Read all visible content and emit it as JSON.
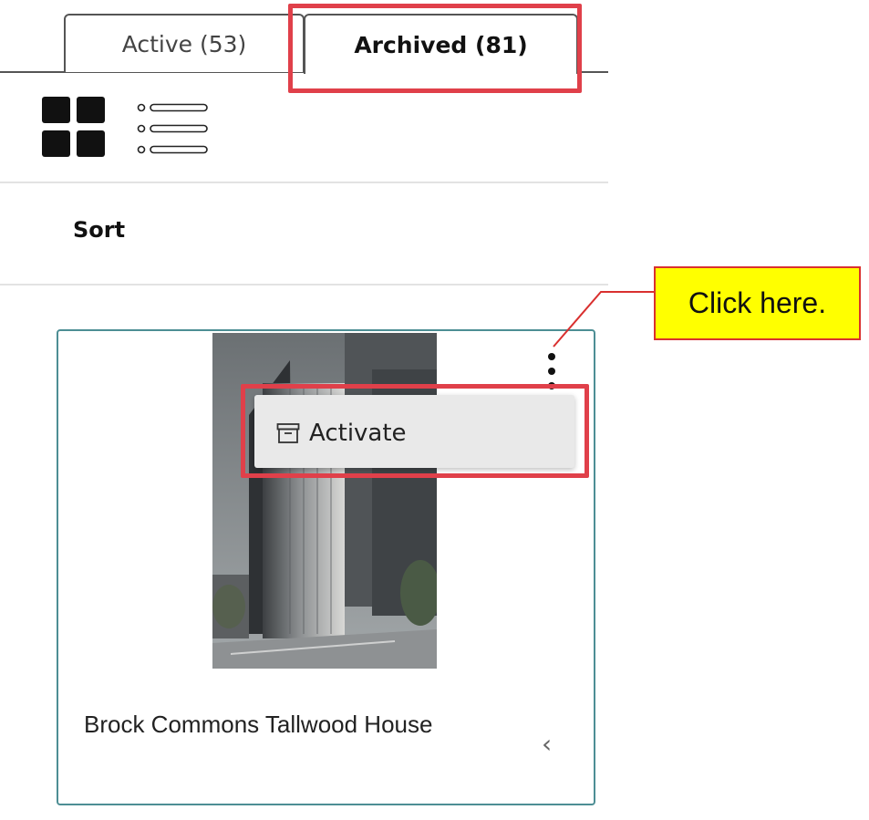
{
  "tabs": [
    {
      "label": "Active (53)"
    },
    {
      "label": "Archived (81)"
    }
  ],
  "view_toggle": {
    "grid_icon": "grid-view-icon",
    "list_icon": "list-view-icon"
  },
  "sort": {
    "label": "Sort"
  },
  "callout": {
    "text": "Click here."
  },
  "card": {
    "title": "Brock Commons Tallwood House",
    "menu_icon": "kebab-menu-icon",
    "chevron_icon": "chevron-left-icon"
  },
  "menu": {
    "items": [
      {
        "label": "Activate",
        "icon": "archive-box-icon"
      }
    ]
  },
  "colors": {
    "highlight": "#e0404a",
    "callout_bg": "#ffff00",
    "card_border": "#4d8e94"
  }
}
